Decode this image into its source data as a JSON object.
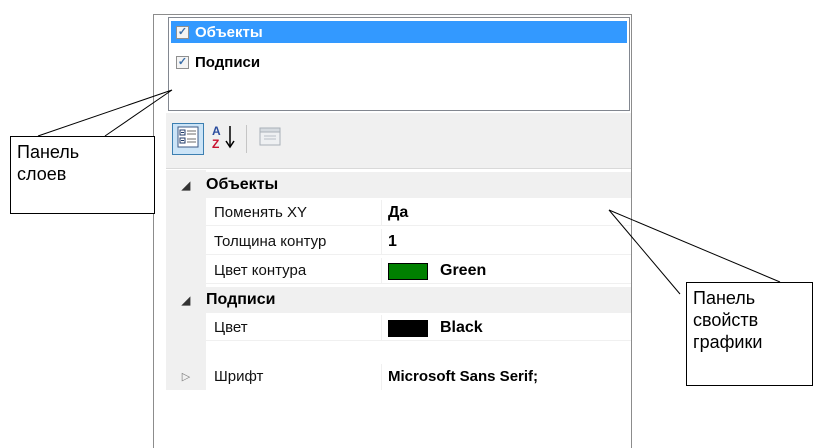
{
  "layers": [
    {
      "label": "Объекты",
      "checked": true,
      "selected": true
    },
    {
      "label": "Подписи",
      "checked": true,
      "selected": false
    }
  ],
  "toolbar": {
    "buttons": [
      {
        "icon": "categorized-icon",
        "active": true
      },
      {
        "icon": "sort-alphabetical-icon",
        "active": false
      },
      {
        "icon": "property-pages-icon",
        "active": false,
        "enabled": false
      }
    ]
  },
  "property_grid": {
    "categories": [
      {
        "label": "Объекты",
        "expanded": true,
        "properties": [
          {
            "name": "Поменять XY",
            "value": "Да"
          },
          {
            "name": "Толщина контур",
            "value": "1"
          },
          {
            "name": "Цвет контура",
            "value": "Green",
            "swatch": "#008000"
          }
        ]
      },
      {
        "label": "Подписи",
        "expanded": true,
        "properties": [
          {
            "name": "Цвет",
            "value": "Black",
            "swatch": "#000000"
          },
          {
            "name": "Шрифт",
            "value": "Microsoft Sans Serif;",
            "collapsed": true
          }
        ]
      }
    ]
  },
  "callouts": {
    "layers_panel": [
      "Панель",
      "слоев"
    ],
    "graphics_properties_panel": [
      "Панель",
      "свойств",
      "графики"
    ]
  },
  "colors": {
    "selection": "#3399ff",
    "category_background": "#f0f0f0",
    "green_swatch": "#008000",
    "black_swatch": "#000000"
  }
}
